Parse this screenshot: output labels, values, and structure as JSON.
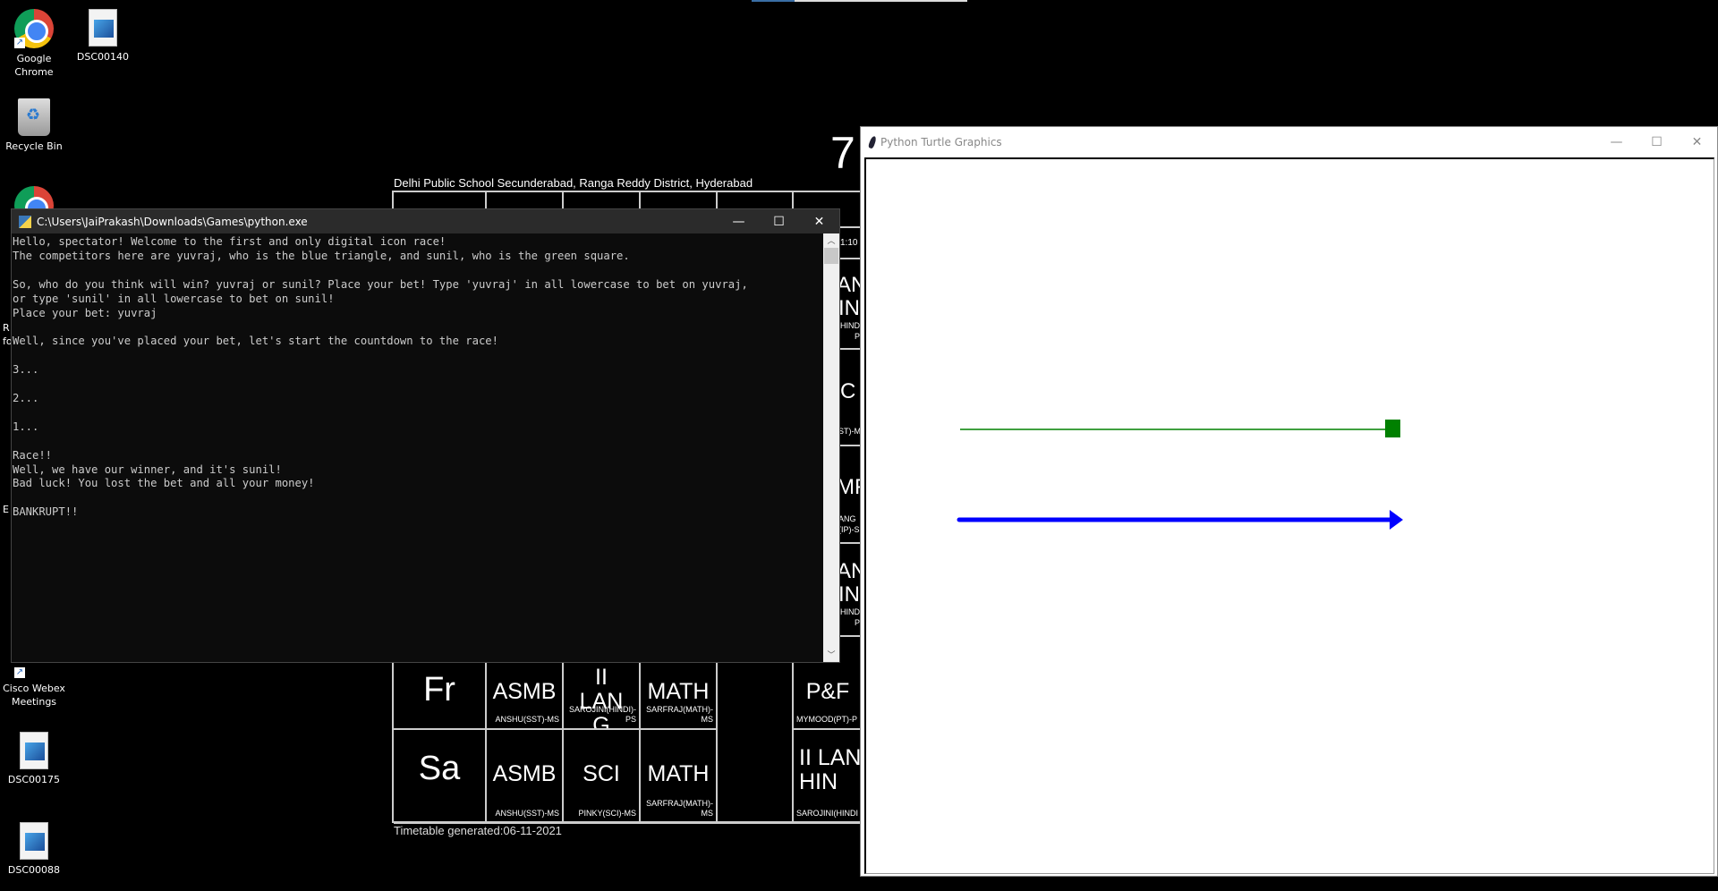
{
  "desktop": {
    "icons": [
      {
        "label": "Google Chrome",
        "icon": "chrome-icon"
      },
      {
        "label": "DSC00140",
        "icon": "image-file-icon"
      },
      {
        "label": "Recycle Bin",
        "icon": "recycle-bin-icon"
      },
      {
        "label": "Cisco Webex Meetings",
        "icon": "webex-icon"
      },
      {
        "label": "DSC00175",
        "icon": "image-file-icon"
      },
      {
        "label": "DSC00088",
        "icon": "image-file-icon"
      }
    ],
    "fragments": [
      "R",
      "fo",
      "E"
    ]
  },
  "timetable": {
    "header": "Delhi Public School Secunderabad, Ranga Reddy District, Hyderabad",
    "corner": "7",
    "footer": "Timetable generated:06-11-2021",
    "edge_fragments": [
      "1:10",
      "AN",
      "IN",
      "HINDI",
      "P",
      "C",
      "ST)-M",
      "MF",
      "ANG",
      "(IP)-S",
      "AN",
      "IN",
      "HINDI",
      "P"
    ],
    "rows": [
      {
        "day": "Fr",
        "cells": [
          {
            "subject": "ASMB",
            "teacher": "ANSHU(SST)-MS"
          },
          {
            "subject": "II LAN G HIN",
            "teacher": "SAROJINI(HINDI)-PS"
          },
          {
            "subject": "MATH",
            "teacher": "SARFRAJ(MATH)-MS"
          },
          {
            "subject": "",
            "teacher": ""
          },
          {
            "subject": "P&F",
            "teacher": "MYMOOD(PT)-P"
          }
        ]
      },
      {
        "day": "Sa",
        "cells": [
          {
            "subject": "ASMB",
            "teacher": "ANSHU(SST)-MS"
          },
          {
            "subject": "SCI",
            "teacher": "PINKY(SCI)-MS"
          },
          {
            "subject": "MATH",
            "teacher": "SARFRAJ(MATH)-MS"
          },
          {
            "subject": "",
            "teacher": ""
          },
          {
            "subject": "II LAN G HIN",
            "teacher": "SAROJINI(HINDI P"
          }
        ]
      }
    ]
  },
  "console": {
    "title": "C:\\Users\\JaiPrakash\\Downloads\\Games\\python.exe",
    "minimize": "—",
    "maximize": "☐",
    "close": "✕",
    "output": "Hello, spectator! Welcome to the first and only digital icon race!\nThe competitors here are yuvraj, who is the blue triangle, and sunil, who is the green square.\n\nSo, who do you think will win? yuvraj or sunil? Place your bet! Type 'yuvraj' in all lowercase to bet on yuvraj,\nor type 'sunil' in all lowercase to bet on sunil!\nPlace your bet: yuvraj\n\nWell, since you've placed your bet, let's start the countdown to the race!\n\n3...\n\n2...\n\n1...\n\nRace!!\nWell, we have our winner, and it's sunil!\nBad luck! You lost the bet and all your money!\n\nBANKRUPT!!"
  },
  "turtle": {
    "title": "Python Turtle Graphics",
    "minimize": "—",
    "maximize": "☐",
    "close": "✕",
    "racers": [
      {
        "name": "sunil",
        "shape": "square",
        "color": "#008000",
        "finished": true
      },
      {
        "name": "yuvraj",
        "shape": "triangle",
        "color": "#0000ff",
        "finished": false
      }
    ]
  }
}
